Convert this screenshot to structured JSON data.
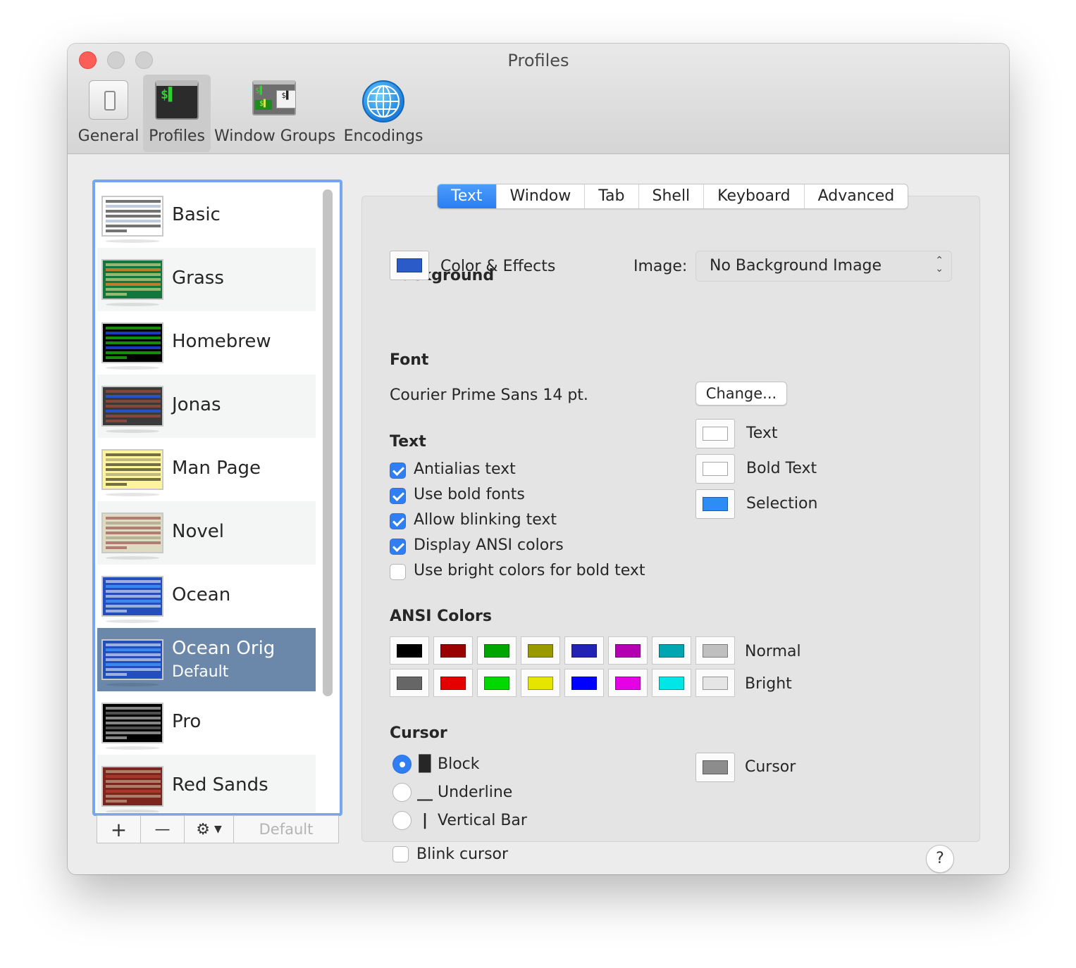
{
  "window": {
    "title": "Profiles"
  },
  "toolbar": [
    {
      "label": "General",
      "icon": "general-switch-icon"
    },
    {
      "label": "Profiles",
      "icon": "terminal-icon"
    },
    {
      "label": "Window Groups",
      "icon": "window-groups-icon"
    },
    {
      "label": "Encodings",
      "icon": "globe-icon"
    }
  ],
  "profiles": [
    {
      "name": "Basic",
      "bg": "#ffffff",
      "bar": "#000000",
      "bar2": "#b7c5da"
    },
    {
      "name": "Grass",
      "bg": "#13773d",
      "bar": "#ffee99",
      "bar2": "#d27d2a"
    },
    {
      "name": "Homebrew",
      "bg": "#000000",
      "bar": "#28fe14",
      "bar2": "#1e3fd1"
    },
    {
      "name": "Jonas",
      "bg": "#3a3a3a",
      "bar": "#c3533d",
      "bar2": "#2359d4"
    },
    {
      "name": "Man Page",
      "bg": "#fef49c",
      "bar": "#000000",
      "bar2": "#b9b37a"
    },
    {
      "name": "Novel",
      "bg": "#dfdbc3",
      "bar": "#8b2e2e",
      "bar2": "#b4ae90"
    },
    {
      "name": "Ocean",
      "bg": "#224fbc",
      "bar": "#ffffff",
      "bar2": "#3e8ef5"
    },
    {
      "name": "Ocean Orig",
      "sub": "Default",
      "bg": "#224fbc",
      "bar": "#ffffff",
      "bar2": "#3e8ef5"
    },
    {
      "name": "Pro",
      "bg": "#000000",
      "bar": "#f2f2f2",
      "bar2": "#5a5a5a"
    },
    {
      "name": "Red Sands",
      "bg": "#7a251e",
      "bar": "#d7c9a7",
      "bar2": "#b03a2e"
    }
  ],
  "list_tools": {
    "add": "+",
    "remove": "—",
    "gear": "⚙",
    "default": "Default"
  },
  "tabs": [
    "Text",
    "Window",
    "Tab",
    "Shell",
    "Keyboard",
    "Advanced"
  ],
  "background": {
    "section": "Background",
    "color_effects": "Color & Effects",
    "color": "#2a5bc8",
    "image_label": "Image:",
    "image_value": "No Background Image"
  },
  "font": {
    "section": "Font",
    "value": "Courier Prime Sans 14 pt.",
    "change": "Change..."
  },
  "text": {
    "section": "Text",
    "options": [
      {
        "label": "Antialias text",
        "checked": true
      },
      {
        "label": "Use bold fonts",
        "checked": true
      },
      {
        "label": "Allow blinking text",
        "checked": true
      },
      {
        "label": "Display ANSI colors",
        "checked": true
      },
      {
        "label": "Use bright colors for bold text",
        "checked": false
      }
    ],
    "colors": [
      {
        "label": "Text",
        "color": "#ffffff"
      },
      {
        "label": "Bold Text",
        "color": "#ffffff"
      },
      {
        "label": "Selection",
        "color": "#2d8cf6"
      }
    ]
  },
  "ansi": {
    "section": "ANSI Colors",
    "normal_label": "Normal",
    "bright_label": "Bright",
    "normal": [
      "#000000",
      "#990000",
      "#00a600",
      "#999900",
      "#2222b3",
      "#b200b2",
      "#00a6b2",
      "#bfbfbf"
    ],
    "bright": [
      "#666666",
      "#e50000",
      "#00d900",
      "#e5e500",
      "#0000ff",
      "#e500e5",
      "#00e5e5",
      "#e5e5e5"
    ]
  },
  "cursor": {
    "section": "Cursor",
    "options": [
      {
        "glyph": "█",
        "label": "Block",
        "selected": true
      },
      {
        "glyph": "__",
        "label": "Underline",
        "selected": false
      },
      {
        "glyph": "|",
        "label": "Vertical Bar",
        "selected": false
      }
    ],
    "blink": "Blink cursor",
    "color_label": "Cursor",
    "color": "#8c8c8c"
  },
  "help": "?"
}
